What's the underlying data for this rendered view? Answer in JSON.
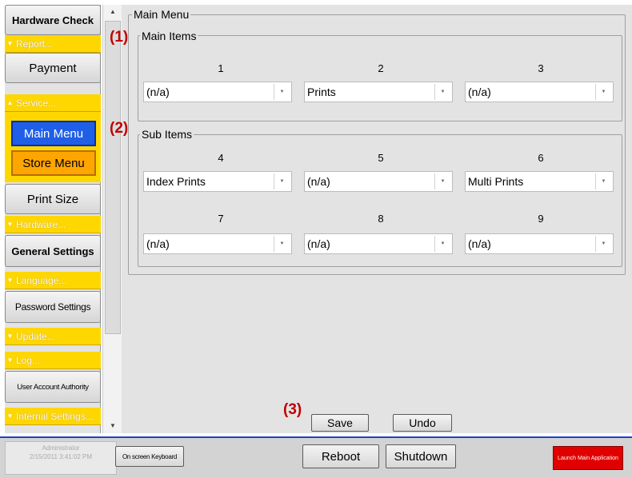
{
  "sidebar": {
    "hardware_check": "Hardware Check",
    "report": "Report...",
    "payment": "Payment",
    "service": "Service...",
    "main_menu": "Main Menu",
    "store_menu": "Store Menu",
    "print_size": "Print Size",
    "hardware": "Hardware...",
    "general_settings": "General Settings",
    "language": "Language...",
    "password_settings": "Password Settings",
    "update": "Update...",
    "log": "Log...",
    "user_account_authority": "User Account Authority",
    "internal_settings": "Internal Settings..."
  },
  "main": {
    "title": "Main Menu",
    "main_items": {
      "label": "Main Items",
      "columns": [
        "1",
        "2",
        "3"
      ],
      "values": [
        "(n/a)",
        "Prints",
        "(n/a)"
      ]
    },
    "sub_items": {
      "label": "Sub Items",
      "row1_columns": [
        "4",
        "5",
        "6"
      ],
      "row1_values": [
        "Index Prints",
        "(n/a)",
        "Multi Prints"
      ],
      "row2_columns": [
        "7",
        "8",
        "9"
      ],
      "row2_values": [
        "(n/a)",
        "(n/a)",
        "(n/a)"
      ]
    },
    "save": "Save",
    "undo": "Undo"
  },
  "annotations": [
    "(1)",
    "(2)",
    "(3)"
  ],
  "statusbar": {
    "user": "Administrator",
    "datetime": "2/15/2011 3:41:02 PM",
    "keyboard": "On screen Keyboard",
    "reboot": "Reboot",
    "shutdown": "Shutdown",
    "launch": "Launch Main Application"
  },
  "colors": {
    "category_yellow": "#ffd700",
    "selected_blue": "#1f5fe8",
    "store_orange": "#ffa500",
    "annotation_red": "#c00000",
    "launch_red": "#e00000"
  }
}
